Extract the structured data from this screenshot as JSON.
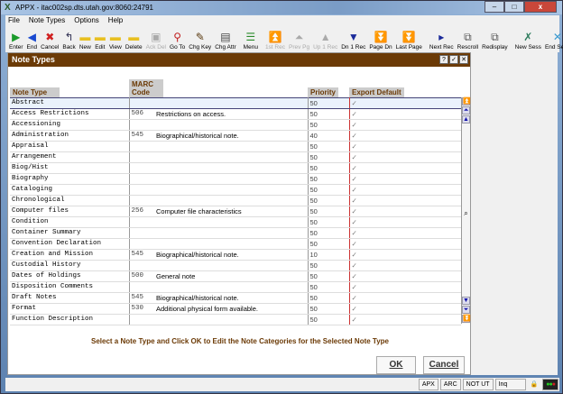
{
  "window": {
    "title": "APPX - itac002sp.dts.utah.gov:8060:24791",
    "controls": [
      "minimize",
      "maximize",
      "close"
    ]
  },
  "menu": [
    "File",
    "Note Types",
    "Options",
    "Help"
  ],
  "toolbar": [
    {
      "label": "Enter",
      "icon": "play-icon",
      "glyph": "▶",
      "color": "#1a9a2a"
    },
    {
      "label": "End",
      "icon": "back-arrow-icon",
      "glyph": "◀",
      "color": "#1a4ad0"
    },
    {
      "label": "Cancel",
      "icon": "cancel-icon",
      "glyph": "✖",
      "color": "#d02020"
    },
    {
      "label": "Back",
      "icon": "back-icon",
      "glyph": "↰",
      "color": "#335"
    },
    {
      "label": "New",
      "icon": "folder-new-icon",
      "glyph": "▬",
      "color": "#e8c020"
    },
    {
      "label": "Edit",
      "icon": "folder-edit-icon",
      "glyph": "▬",
      "color": "#e8c020"
    },
    {
      "label": "View",
      "icon": "folder-view-icon",
      "glyph": "▬",
      "color": "#e8c020"
    },
    {
      "label": "Delete",
      "icon": "folder-delete-icon",
      "glyph": "▬",
      "color": "#e8c020"
    },
    {
      "label": "Ack Del",
      "icon": "tv-icon",
      "glyph": "▣",
      "color": "#aaa",
      "disabled": true
    },
    {
      "label": "Go To",
      "icon": "magnifier-icon",
      "glyph": "⚲",
      "color": "#c02020"
    },
    {
      "label": "Chg Key",
      "icon": "brush-icon",
      "glyph": "✎",
      "color": "#5a3a10"
    },
    {
      "label": "Chg Attr",
      "icon": "attr-icon",
      "glyph": "▤",
      "color": "#444"
    },
    {
      "sep": true
    },
    {
      "label": "Menu",
      "icon": "menu-icon",
      "glyph": "☰",
      "color": "#2a8a2a"
    },
    {
      "sep": true
    },
    {
      "label": "1st Rec",
      "icon": "first-record-icon",
      "glyph": "⏫",
      "color": "#aaa",
      "disabled": true
    },
    {
      "label": "Prev Pg",
      "icon": "previous-page-icon",
      "glyph": "⏶",
      "color": "#aaa",
      "disabled": true
    },
    {
      "label": "Up 1 Rec",
      "icon": "up-record-icon",
      "glyph": "▲",
      "color": "#aaa",
      "disabled": true
    },
    {
      "label": "Dn 1 Rec",
      "icon": "down-record-icon",
      "glyph": "▼",
      "color": "#1a2a9a"
    },
    {
      "label": "Page Dn",
      "icon": "page-down-icon",
      "glyph": "⏬",
      "color": "#1a2a9a"
    },
    {
      "label": "Last Page",
      "icon": "last-page-icon",
      "glyph": "⏬",
      "color": "#1a2a9a"
    },
    {
      "sep": true
    },
    {
      "label": "Next Rec",
      "icon": "next-record-icon",
      "glyph": "▸",
      "color": "#1a2a9a"
    },
    {
      "label": "Rescroll",
      "icon": "rescroll-icon",
      "glyph": "⧉",
      "color": "#555"
    },
    {
      "label": "Redisplay",
      "icon": "redisplay-icon",
      "glyph": "⧉",
      "color": "#555"
    },
    {
      "sep": true
    },
    {
      "label": "New Sess",
      "icon": "new-session-icon",
      "glyph": "✗",
      "color": "#2a7a5a"
    },
    {
      "label": "End Sess",
      "icon": "end-session-icon",
      "glyph": "✕",
      "color": "#3a9ad0"
    },
    {
      "sep": true
    },
    {
      "label": "Print",
      "icon": "printer-icon",
      "glyph": "⎙",
      "color": "#333"
    }
  ],
  "dialog": {
    "title": "Note Types",
    "buttons": [
      "?",
      "✓",
      "✕"
    ],
    "columns": {
      "note_type": "Note Type",
      "marc_code": "MARC Code",
      "priority": "Priority",
      "export_default": "Export Default"
    },
    "rows": [
      {
        "type": "Abstract",
        "code": "",
        "desc": "",
        "priority": "50",
        "export": "✓"
      },
      {
        "type": "Access Restrictions",
        "code": "506",
        "desc": "Restrictions on access.",
        "priority": "50",
        "export": "✓"
      },
      {
        "type": "Accessioning",
        "code": "",
        "desc": "",
        "priority": "50",
        "export": "✓"
      },
      {
        "type": "Administration",
        "code": "545",
        "desc": "Biographical/historical note.",
        "priority": "40",
        "export": "✓"
      },
      {
        "type": "Appraisal",
        "code": "",
        "desc": "",
        "priority": "50",
        "export": "✓"
      },
      {
        "type": "Arrangement",
        "code": "",
        "desc": "",
        "priority": "50",
        "export": "✓"
      },
      {
        "type": "Biog/Hist",
        "code": "",
        "desc": "",
        "priority": "50",
        "export": "✓"
      },
      {
        "type": "Biography",
        "code": "",
        "desc": "",
        "priority": "50",
        "export": "✓"
      },
      {
        "type": "Cataloging",
        "code": "",
        "desc": "",
        "priority": "50",
        "export": "✓"
      },
      {
        "type": "Chronological",
        "code": "",
        "desc": "",
        "priority": "50",
        "export": "✓"
      },
      {
        "type": "Computer files",
        "code": "256",
        "desc": "Computer file characteristics",
        "priority": "50",
        "export": "✓"
      },
      {
        "type": "Condition",
        "code": "",
        "desc": "",
        "priority": "50",
        "export": "✓"
      },
      {
        "type": "Container Summary",
        "code": "",
        "desc": "",
        "priority": "50",
        "export": "✓"
      },
      {
        "type": "Convention Declaration",
        "code": "",
        "desc": "",
        "priority": "50",
        "export": "✓"
      },
      {
        "type": "Creation and Mission",
        "code": "545",
        "desc": "Biographical/historical note.",
        "priority": "10",
        "export": "✓"
      },
      {
        "type": "Custodial History",
        "code": "",
        "desc": "",
        "priority": "50",
        "export": "✓"
      },
      {
        "type": "Dates of Holdings",
        "code": "500",
        "desc": "General note",
        "priority": "50",
        "export": "✓"
      },
      {
        "type": "Disposition Comments",
        "code": "",
        "desc": "",
        "priority": "50",
        "export": "✓"
      },
      {
        "type": "Draft Notes",
        "code": "545",
        "desc": "Biographical/historical note.",
        "priority": "50",
        "export": "✓"
      },
      {
        "type": "Format",
        "code": "530",
        "desc": "Additional physical form available.",
        "priority": "50",
        "export": "✓"
      },
      {
        "type": "Function Description",
        "code": "",
        "desc": "",
        "priority": "50",
        "export": "✓"
      }
    ],
    "message": "Select a Note Type and Click OK to Edit the Note Categories for the Selected Note Type",
    "ok": "OK",
    "cancel": "Cancel"
  },
  "status": [
    "APX",
    "ARC",
    "NOT UT",
    "Inq"
  ],
  "colors": {
    "dialog_title": "#6b3a06",
    "header_text": "#6b3a06",
    "selection": "#eaf2fc"
  }
}
